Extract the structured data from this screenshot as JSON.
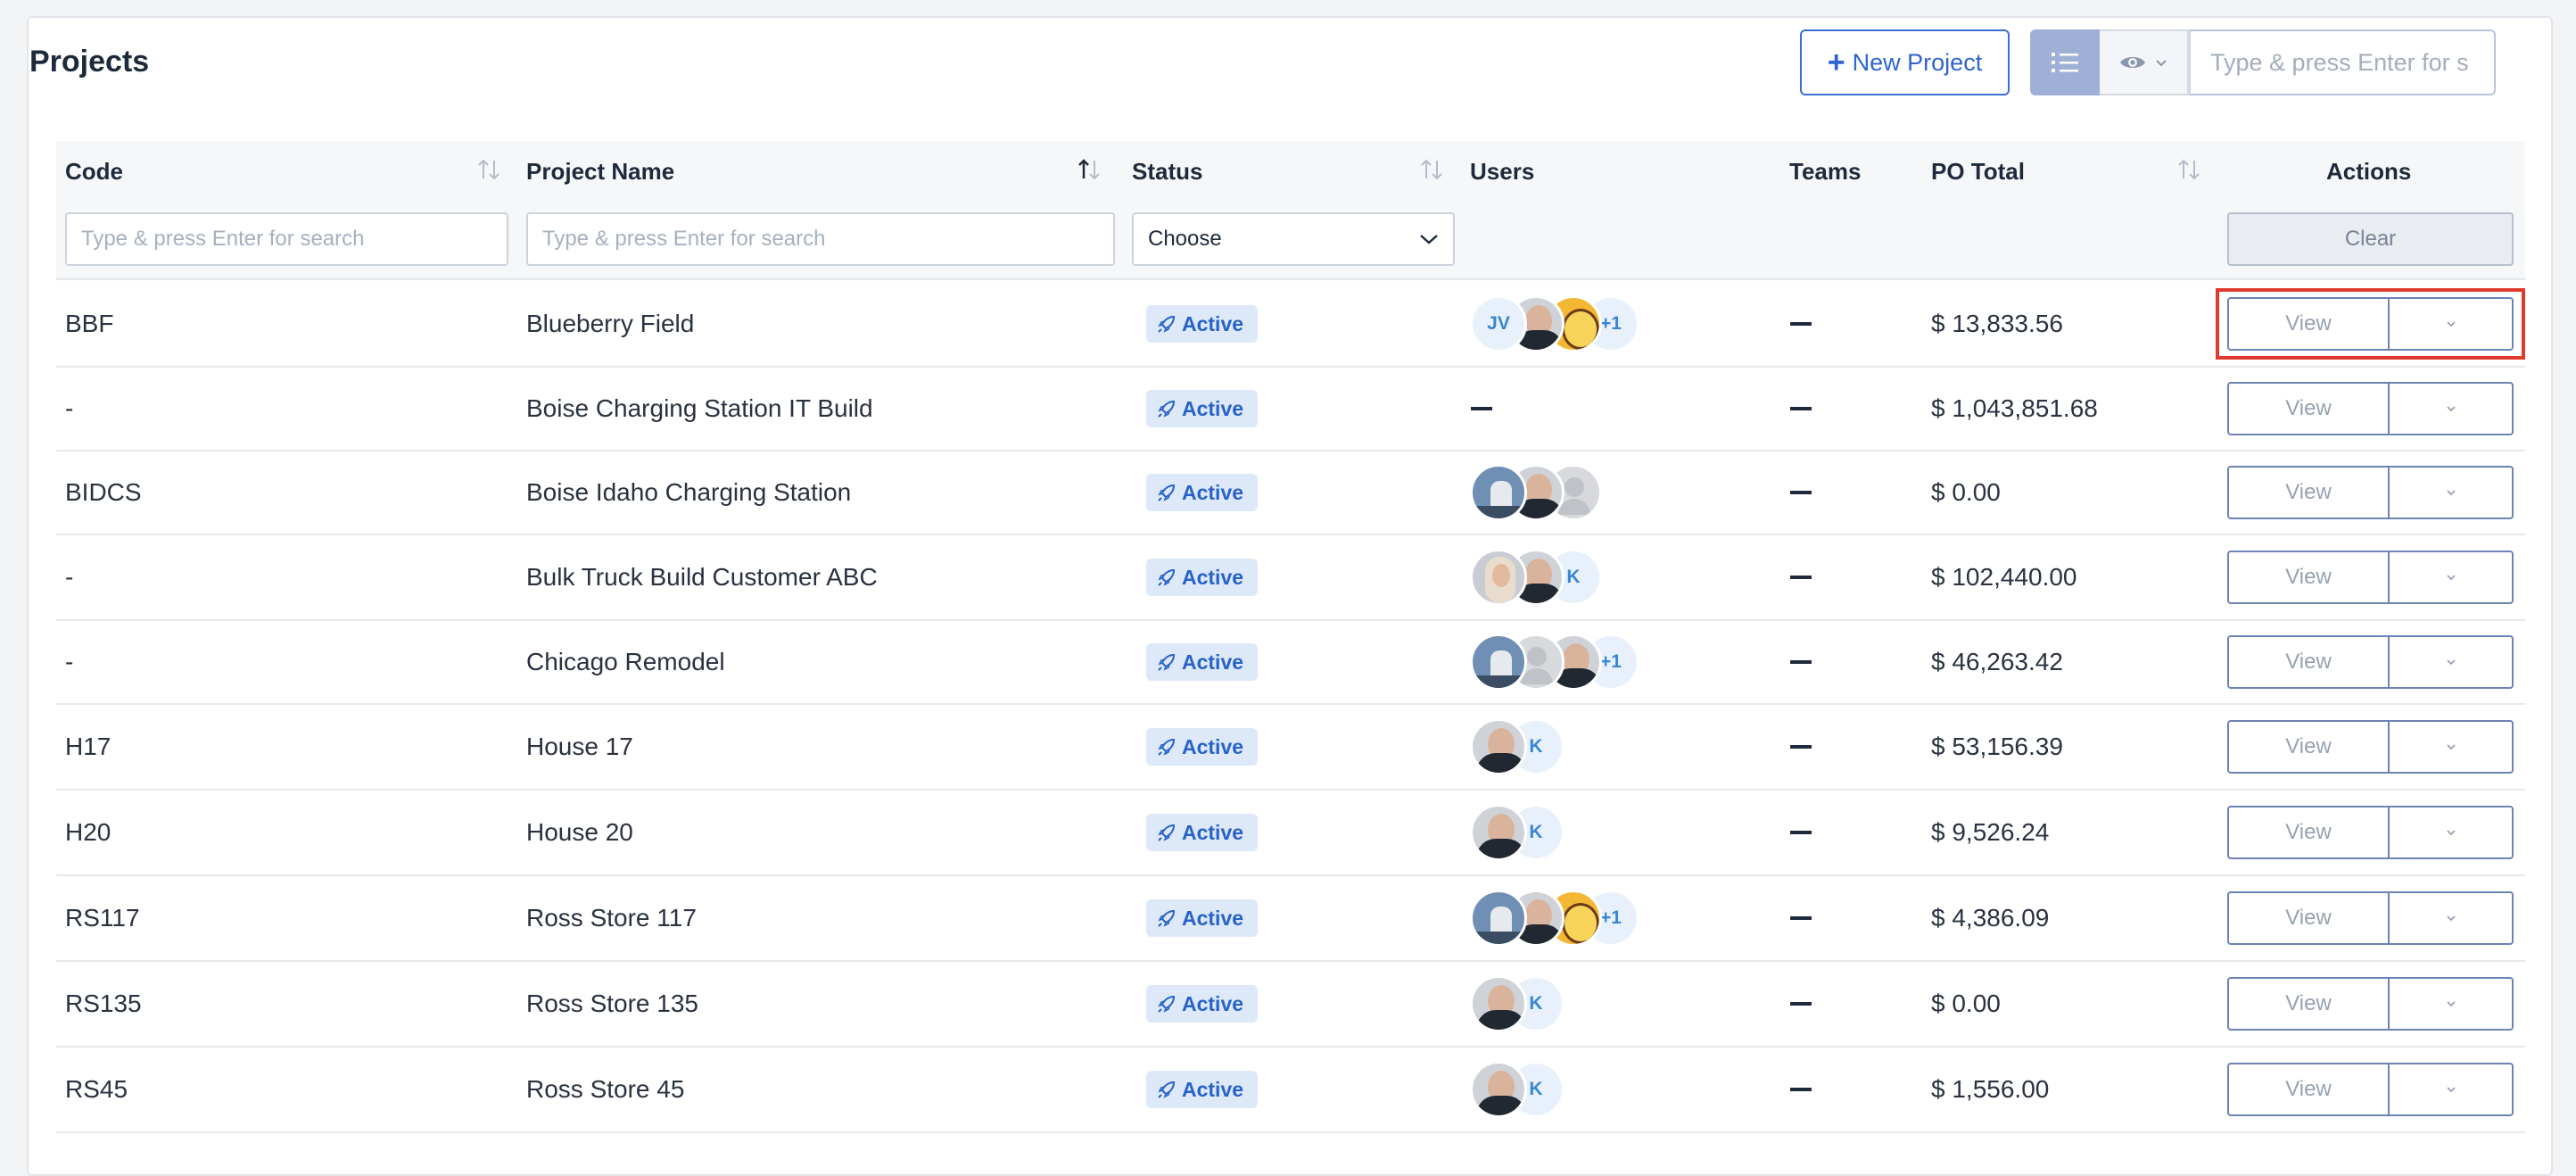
{
  "page": {
    "title": "Projects"
  },
  "toolbar": {
    "new_project_label": "New Project",
    "search_placeholder": "Type & press Enter for s"
  },
  "columns": {
    "code": "Code",
    "project_name": "Project Name",
    "status": "Status",
    "users": "Users",
    "teams": "Teams",
    "po_total": "PO Total",
    "actions": "Actions"
  },
  "filters": {
    "code_placeholder": "Type & press Enter for search",
    "name_placeholder": "Type & press Enter for search",
    "status_value": "Choose",
    "clear_label": "Clear"
  },
  "row_actions": {
    "view_label": "View"
  },
  "rows": [
    {
      "code": "BBF",
      "name": "Blueberry Field",
      "status": "Active",
      "users": [
        "JV",
        "photo-man",
        "photo-cartoon",
        "+1"
      ],
      "po_total": "$ 13,833.56"
    },
    {
      "code": "-",
      "name": "Boise Charging Station IT Build",
      "status": "Active",
      "users": [],
      "po_total": "$ 1,043,851.68"
    },
    {
      "code": "BIDCS",
      "name": "Boise Idaho Charging Station",
      "status": "Active",
      "users": [
        "photo-city",
        "photo-man",
        "photo-blank"
      ],
      "po_total": "$ 0.00"
    },
    {
      "code": "-",
      "name": "Bulk Truck Build Customer ABC",
      "status": "Active",
      "users": [
        "photo-woman",
        "photo-man",
        "K"
      ],
      "po_total": "$ 102,440.00"
    },
    {
      "code": "-",
      "name": "Chicago Remodel",
      "status": "Active",
      "users": [
        "photo-city",
        "photo-blank",
        "photo-man",
        "+1"
      ],
      "po_total": "$ 46,263.42"
    },
    {
      "code": "H17",
      "name": "House 17",
      "status": "Active",
      "users": [
        "photo-man",
        "K"
      ],
      "po_total": "$ 53,156.39"
    },
    {
      "code": "H20",
      "name": "House 20",
      "status": "Active",
      "users": [
        "photo-man",
        "K"
      ],
      "po_total": "$ 9,526.24"
    },
    {
      "code": "RS117",
      "name": "Ross Store 117",
      "status": "Active",
      "users": [
        "photo-city",
        "photo-man",
        "photo-cartoon",
        "+1"
      ],
      "po_total": "$ 4,386.09"
    },
    {
      "code": "RS135",
      "name": "Ross Store 135",
      "status": "Active",
      "users": [
        "photo-man",
        "K"
      ],
      "po_total": "$ 0.00"
    },
    {
      "code": "RS45",
      "name": "Ross Store 45",
      "status": "Active",
      "users": [
        "photo-man",
        "K"
      ],
      "po_total": "$ 1,556.00"
    }
  ],
  "colors": {
    "accent": "#2f64cf",
    "badge_bg": "#dde8f8",
    "highlight": "#e03a2f"
  }
}
